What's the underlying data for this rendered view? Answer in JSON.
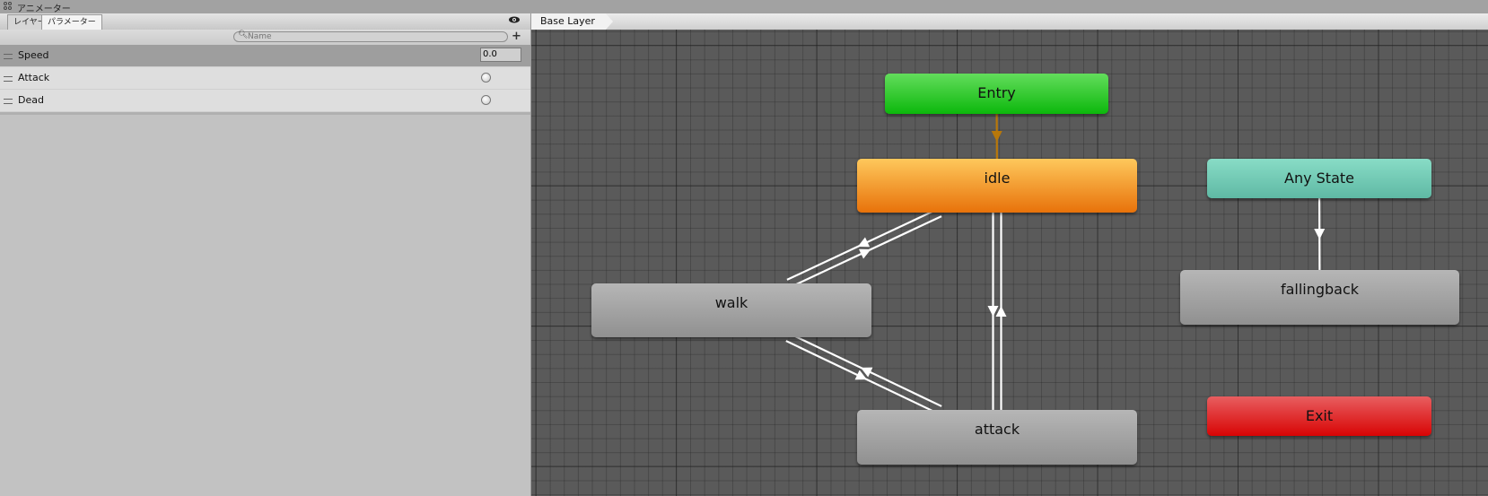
{
  "window": {
    "title": "アニメーター",
    "icon": "animator-icon"
  },
  "left_panel": {
    "tabs": [
      {
        "label": "レイヤー",
        "active": false
      },
      {
        "label": "パラメーター",
        "active": true
      }
    ],
    "eye_icon": "eye-icon",
    "search": {
      "placeholder": "Name",
      "value": "",
      "icon": "search-icon"
    },
    "add_label": "+",
    "parameters": [
      {
        "name": "Speed",
        "type": "float",
        "value": "0.0",
        "selected": true
      },
      {
        "name": "Attack",
        "type": "trigger",
        "value": false
      },
      {
        "name": "Dead",
        "type": "trigger",
        "value": false
      }
    ]
  },
  "graph": {
    "breadcrumb": "Base Layer",
    "states": [
      {
        "id": "entry",
        "label": "Entry",
        "kind": "entry"
      },
      {
        "id": "idle",
        "label": "idle",
        "kind": "default"
      },
      {
        "id": "any",
        "label": "Any State",
        "kind": "any"
      },
      {
        "id": "walk",
        "label": "walk",
        "kind": "state"
      },
      {
        "id": "fallingback",
        "label": "fallingback",
        "kind": "state"
      },
      {
        "id": "attack",
        "label": "attack",
        "kind": "state"
      },
      {
        "id": "exit",
        "label": "Exit",
        "kind": "exit"
      }
    ],
    "transitions": [
      {
        "from": "entry",
        "to": "idle",
        "color": "#b8780a"
      },
      {
        "from": "idle",
        "to": "walk",
        "color": "#ffffff"
      },
      {
        "from": "walk",
        "to": "idle",
        "color": "#ffffff"
      },
      {
        "from": "walk",
        "to": "attack",
        "color": "#ffffff"
      },
      {
        "from": "attack",
        "to": "walk",
        "color": "#ffffff"
      },
      {
        "from": "idle",
        "to": "attack",
        "color": "#ffffff"
      },
      {
        "from": "attack",
        "to": "idle",
        "color": "#ffffff"
      },
      {
        "from": "any",
        "to": "fallingback",
        "color": "#ffffff"
      }
    ]
  }
}
